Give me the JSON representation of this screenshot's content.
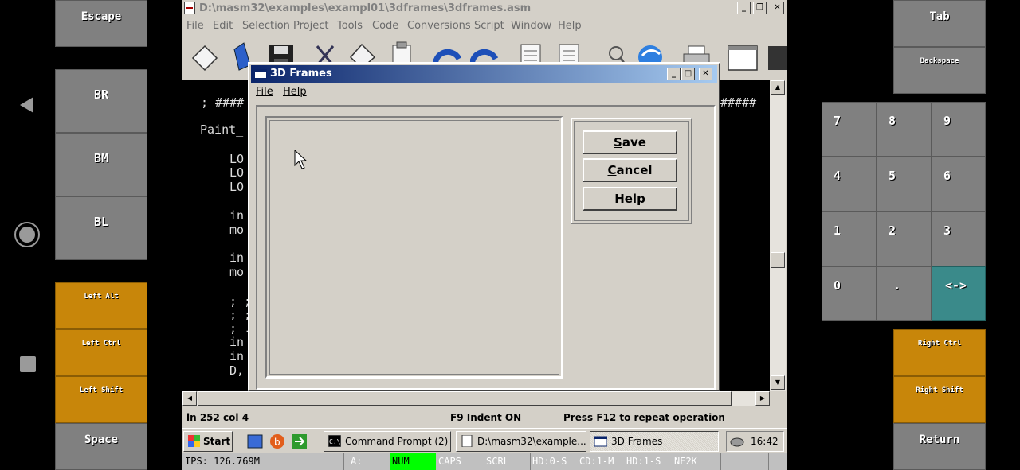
{
  "left_keys": {
    "escape": "Escape",
    "br": "BR",
    "bm": "BM",
    "bl": "BL",
    "left_alt": "Left Alt",
    "left_ctrl": "Left Ctrl",
    "left_shift": "Left Shift",
    "space": "Space"
  },
  "right_keys": {
    "tab": "Tab",
    "backspace": "Backspace",
    "numpad": [
      "7",
      "8",
      "9",
      "4",
      "5",
      "6",
      "1",
      "2",
      "3",
      "0",
      ".",
      "<->"
    ],
    "right_ctrl": "Right Ctrl",
    "right_shift": "Right Shift",
    "return": "Return"
  },
  "editor": {
    "title": "D:\\masm32\\examples\\exampl01\\3dframes\\3dframes.asm",
    "menu": [
      "File",
      "Edit",
      "Selection",
      "Project",
      "Tools",
      "Code",
      "Conversions",
      "Script",
      "Window",
      "Help"
    ],
    "code_lines": [
      "; ####",
      "Paint_",
      "LO",
      "LO",
      "LO",
      "in",
      "mo",
      "in",
      "mo",
      "; ;",
      "; ;",
      "; .",
      "in",
      "in",
      "D,",
      "#####"
    ],
    "status": {
      "position": "ln 252 col 4",
      "indent": "F9 Indent ON",
      "hint": "Press F12 to repeat operation"
    }
  },
  "dialog": {
    "title": "3D Frames",
    "menu": [
      "File",
      "Help"
    ],
    "buttons": {
      "save_accel": "S",
      "save_rest": "ave",
      "cancel_accel": "C",
      "cancel_rest": "ancel",
      "help_accel": "H",
      "help_rest": "elp"
    }
  },
  "taskbar": {
    "start": "Start",
    "tasks": [
      "Command Prompt (2)",
      "D:\\masm32\\example...",
      "3D Frames"
    ],
    "clock": "16:42"
  },
  "dosbox_status": {
    "ips": "IPS: 126.769M",
    "drive": "A:",
    "num": "NUM",
    "caps": "CAPS",
    "scrl": "SCRL",
    "hd0": "HD:0-S",
    "cd1": "CD:1-M",
    "hd1": "HD:1-S",
    "ne2k": "NE2K"
  },
  "colors": {
    "key_gray": "#808080",
    "key_orange": "#c8860a",
    "key_teal": "#3a8a8a",
    "win_face": "#d4d0c8",
    "title_active": "#0a246a",
    "num_on": "#00ff00"
  }
}
